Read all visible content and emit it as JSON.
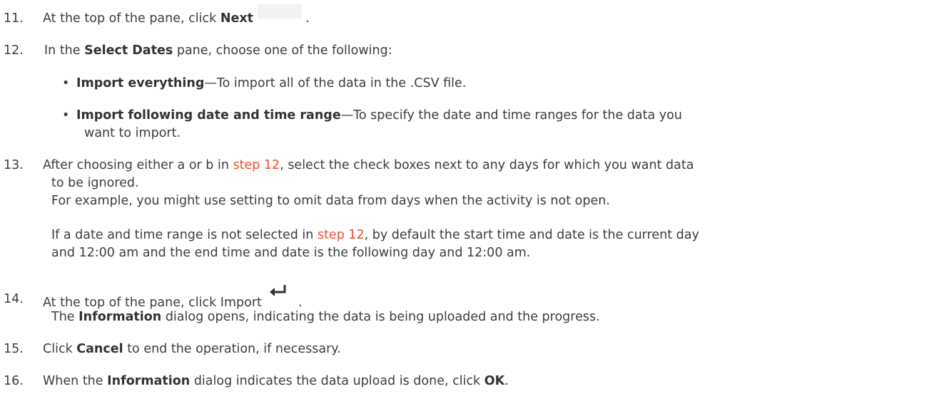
{
  "steps": [
    {
      "num": "11.",
      "pre": "At the top of the pane, click ",
      "bold": "Next",
      "post": " ."
    },
    {
      "num": "12.",
      "pre": "In the ",
      "bold": "Select Dates",
      "post": " pane, choose one of the following:"
    },
    {
      "num": "13.",
      "line1_pre": "After choosing either a or b in ",
      "link": "step 12",
      "line1_post": ", select the check boxes next to any days for which you want data",
      "line2": "to be ignored.",
      "line3": "For example, you might use setting to omit data from days when the activity is not open.",
      "line4_pre": "If a date and time range is not selected in ",
      "line4_link": "step 12",
      "line4_post": ", by default the start time and date is the current day",
      "line5": "and 12:00 am and the end time and date is the following day and 12:00 am."
    },
    {
      "num": "14.",
      "pre": "At the top of the pane, click Import ",
      "post": " .",
      "line2_pre": "The ",
      "line2_bold": "Information",
      "line2_post": " dialog opens, indicating the data is being uploaded and the progress."
    },
    {
      "num": "15.",
      "pre": "Click ",
      "bold": "Cancel",
      "post": " to end the operation, if necessary."
    },
    {
      "num": "16.",
      "pre": "When the ",
      "bold": "Information",
      "mid": " dialog indicates the data upload is done, click ",
      "bold2": "OK",
      "post": "."
    }
  ],
  "bullets": [
    {
      "bold": "Import everything",
      "text": "—To import all of the data in the .CSV file."
    },
    {
      "bold": "Import following date and time range",
      "text": "—To specify the date and time ranges for the data you",
      "text2": "want to import."
    }
  ],
  "icons": {
    "next": "next-arrow-icon",
    "import": "import-enter-icon"
  }
}
